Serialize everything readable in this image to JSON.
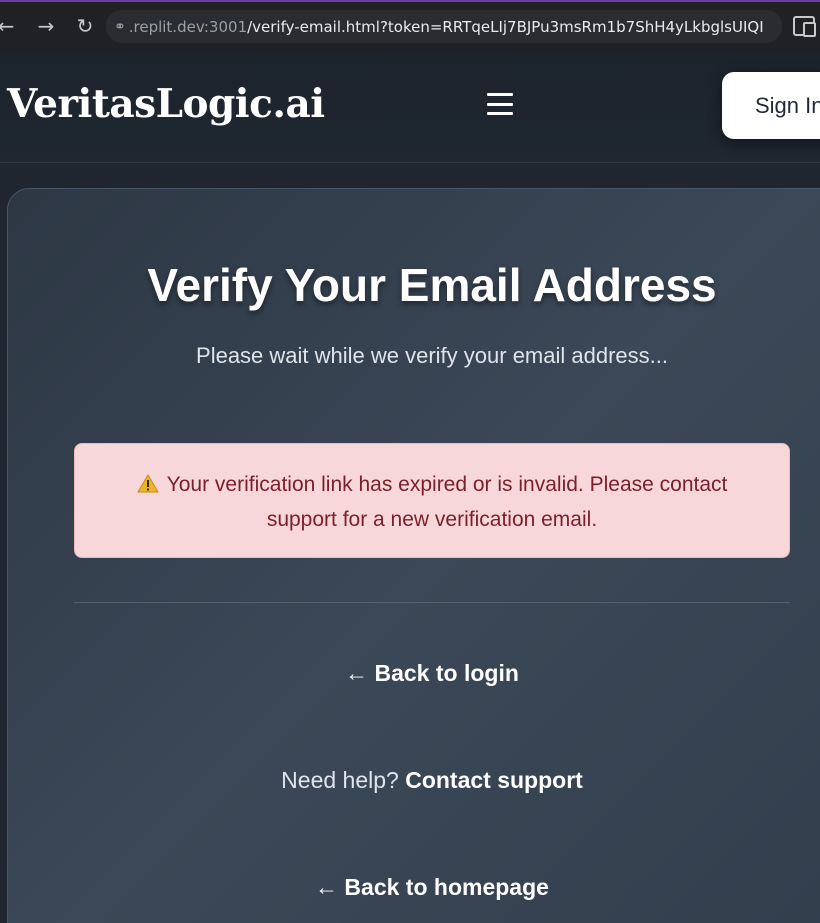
{
  "browser": {
    "url_host": ".replit.dev:3001",
    "url_path": "/verify-email.html?token=RRTqeLIj7BJPu3msRm1b7ShH4yLkbglsUIQI"
  },
  "header": {
    "logo": "VeritasLogic.ai",
    "sign_in_label": "Sign In"
  },
  "card": {
    "title": "Verify Your Email Address",
    "subtitle": "Please wait while we verify your email address...",
    "alert_text": "Your verification link has expired or is invalid. Please contact support for a new verification email.",
    "back_to_login": "← Back to login",
    "help_prefix": "Need help?",
    "contact_support": "Contact support",
    "back_to_homepage": "← Back to homepage"
  },
  "colors": {
    "alert_bg": "#f8d7da",
    "alert_text": "#7b1f2a",
    "warning_icon": "#f0b429"
  }
}
